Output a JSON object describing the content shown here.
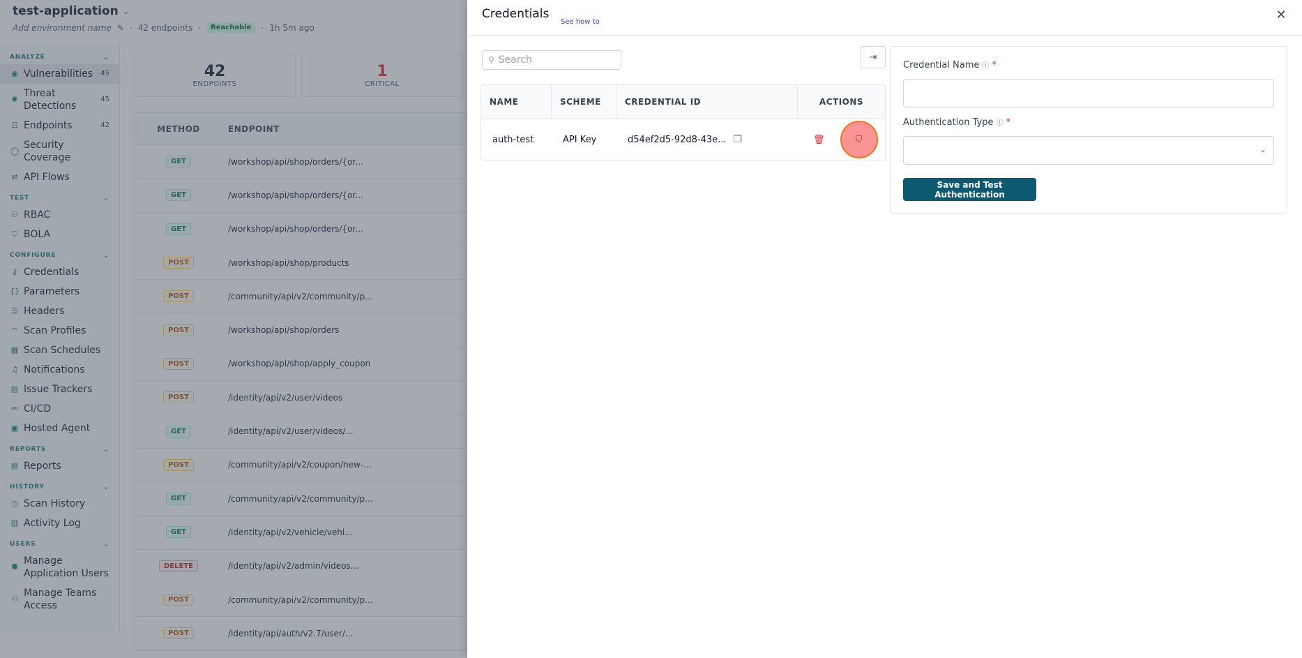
{
  "app": {
    "title": "test-application",
    "env_placeholder": "Add environment name",
    "endpoints_count": "42 endpoints",
    "reachable": "Reachable",
    "last_seen": "1h 5m ago"
  },
  "sidebar": {
    "sections": [
      {
        "label": "ANALYZE",
        "items": [
          {
            "label": "Vulnerabilities",
            "count": "45",
            "icon": "shield-alert-icon",
            "glyph": "◉",
            "active": true
          },
          {
            "label": "Threat Detections",
            "count": "45",
            "icon": "threat-icon",
            "glyph": "✺"
          },
          {
            "label": "Endpoints",
            "count": "42",
            "icon": "endpoints-icon",
            "glyph": "☷"
          },
          {
            "label": "Security Coverage",
            "icon": "coverage-icon",
            "glyph": "◯"
          },
          {
            "label": "API Flows",
            "icon": "flows-icon",
            "glyph": "⇄"
          }
        ]
      },
      {
        "label": "TEST",
        "items": [
          {
            "label": "RBAC",
            "icon": "rbac-icon",
            "glyph": "⚇"
          },
          {
            "label": "BOLA",
            "icon": "bola-icon",
            "glyph": "⛉"
          }
        ]
      },
      {
        "label": "CONFIGURE",
        "items": [
          {
            "label": "Credentials",
            "icon": "key-icon",
            "glyph": "⚷"
          },
          {
            "label": "Parameters",
            "icon": "braces-icon",
            "glyph": "{}"
          },
          {
            "label": "Headers",
            "icon": "headers-icon",
            "glyph": "☰"
          },
          {
            "label": "Scan Profiles",
            "icon": "gauge-icon",
            "glyph": "◠"
          },
          {
            "label": "Scan Schedules",
            "icon": "calendar-icon",
            "glyph": "▦"
          },
          {
            "label": "Notifications",
            "icon": "bell-icon",
            "glyph": "♫"
          },
          {
            "label": "Issue Trackers",
            "icon": "tracker-icon",
            "glyph": "▤"
          },
          {
            "label": "CI/CD",
            "icon": "pipeline-icon",
            "glyph": "⚯"
          },
          {
            "label": "Hosted Agent",
            "icon": "agent-icon",
            "glyph": "▣"
          }
        ]
      },
      {
        "label": "REPORTS",
        "items": [
          {
            "label": "Reports",
            "icon": "report-icon",
            "glyph": "▤"
          }
        ]
      },
      {
        "label": "HISTORY",
        "items": [
          {
            "label": "Scan History",
            "icon": "history-icon",
            "glyph": "◷"
          },
          {
            "label": "Activity Log",
            "icon": "log-icon",
            "glyph": "▥"
          }
        ]
      },
      {
        "label": "USERS",
        "items": [
          {
            "label": "Manage Application Users",
            "icon": "users-icon",
            "glyph": "⚉"
          },
          {
            "label": "Manage Teams Access",
            "icon": "teams-icon",
            "glyph": "⚇"
          }
        ]
      }
    ]
  },
  "stats": [
    {
      "value": "42",
      "label": "ENDPOINTS",
      "red": false
    },
    {
      "value": "1",
      "label": "CRITICAL",
      "red": true
    }
  ],
  "endpoints_table": {
    "columns": [
      "METHOD",
      "ENDPOINT"
    ],
    "rows": [
      {
        "method": "GET",
        "path": "/workshop/api/shop/orders/{or..."
      },
      {
        "method": "GET",
        "path": "/workshop/api/shop/orders/{or..."
      },
      {
        "method": "GET",
        "path": "/workshop/api/shop/orders/{or..."
      },
      {
        "method": "POST",
        "path": "/workshop/api/shop/products"
      },
      {
        "method": "POST",
        "path": "/community/api/v2/community/p..."
      },
      {
        "method": "POST",
        "path": "/workshop/api/shop/orders"
      },
      {
        "method": "POST",
        "path": "/workshop/api/shop/apply_coupon"
      },
      {
        "method": "POST",
        "path": "/identity/api/v2/user/videos"
      },
      {
        "method": "GET",
        "path": "/identity/api/v2/user/videos/..."
      },
      {
        "method": "POST",
        "path": "/community/api/v2/coupon/new-..."
      },
      {
        "method": "GET",
        "path": "/community/api/v2/community/p..."
      },
      {
        "method": "GET",
        "path": "/identity/api/v2/vehicle/vehi..."
      },
      {
        "method": "DELETE",
        "path": "/identity/api/v2/admin/videos..."
      },
      {
        "method": "POST",
        "path": "/community/api/v2/community/p..."
      },
      {
        "method": "POST",
        "path": "/identity/api/auth/v2.7/user/..."
      }
    ]
  },
  "drawer": {
    "title": "Credentials",
    "see_how": "See how to",
    "search_placeholder": "Search",
    "table": {
      "columns": {
        "name": "NAME",
        "scheme": "SCHEME",
        "credential_id": "CREDENTIAL ID",
        "actions": "ACTIONS"
      },
      "rows": [
        {
          "name": "auth-test",
          "scheme": "API Key",
          "credential_id": "d54ef2d5-92d8-43e..."
        }
      ]
    },
    "form": {
      "name_label": "Credential Name",
      "name_value": "",
      "type_label": "Authentication Type",
      "type_value": "",
      "submit": "Save and Test Authentication"
    }
  }
}
